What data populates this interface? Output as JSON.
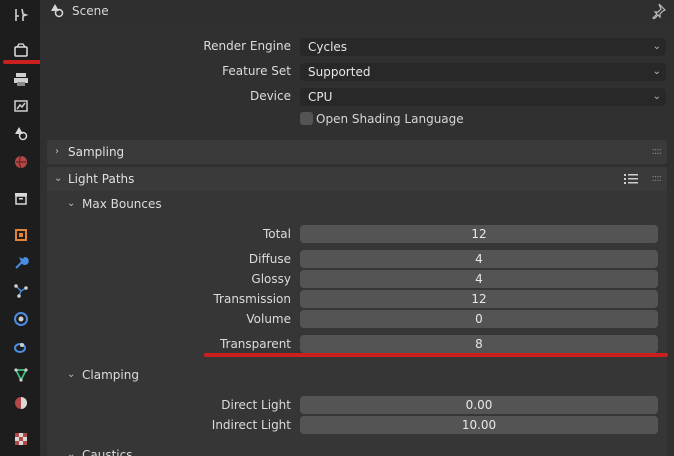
{
  "header": {
    "title": "Scene"
  },
  "render": {
    "engine_label": "Render Engine",
    "engine_value": "Cycles",
    "feature_label": "Feature Set",
    "feature_value": "Supported",
    "device_label": "Device",
    "device_value": "CPU",
    "osl_label": "Open Shading Language"
  },
  "sampling": {
    "title": "Sampling"
  },
  "light_paths": {
    "title": "Light Paths",
    "max_bounces": {
      "title": "Max Bounces",
      "rows": [
        {
          "label": "Total",
          "value": "12"
        },
        {
          "label": "Diffuse",
          "value": "4"
        },
        {
          "label": "Glossy",
          "value": "4"
        },
        {
          "label": "Transmission",
          "value": "12"
        },
        {
          "label": "Volume",
          "value": "0"
        },
        {
          "label": "Transparent",
          "value": "8"
        }
      ]
    },
    "clamping": {
      "title": "Clamping",
      "rows": [
        {
          "label": "Direct Light",
          "value": "0.00"
        },
        {
          "label": "Indirect Light",
          "value": "10.00"
        }
      ]
    },
    "caustics": {
      "title": "Caustics"
    }
  },
  "colors": {
    "accent": "#cc1f1f"
  }
}
